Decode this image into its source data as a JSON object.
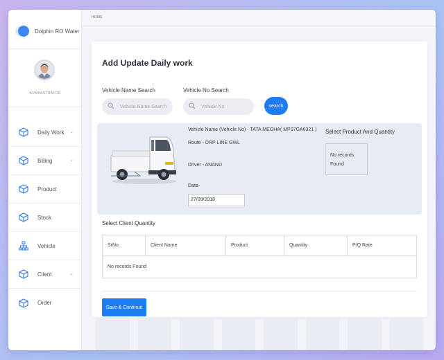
{
  "brand": {
    "name": "Dolphin RO Water"
  },
  "profile": {
    "role": "ADMINISTRATOR"
  },
  "sidebar": {
    "items": [
      {
        "label": "Daily Work",
        "icon": "cube-icon",
        "chevron": true
      },
      {
        "label": "Billing",
        "icon": "cube-icon",
        "chevron": true
      },
      {
        "label": "Product",
        "icon": "cube-icon",
        "chevron": false
      },
      {
        "label": "Stock",
        "icon": "cube-icon",
        "chevron": false
      },
      {
        "label": "Vehicle",
        "icon": "sitemap-icon",
        "chevron": false
      },
      {
        "label": "Client",
        "icon": "cube-icon",
        "chevron": true
      },
      {
        "label": "Order",
        "icon": "cube-icon",
        "chevron": false
      }
    ]
  },
  "breadcrumb": {
    "home": "HOME"
  },
  "form": {
    "title": "Add Update Daily work",
    "vehicle_name_label": "Vehicle Name Search",
    "vehicle_name_placeholder": "Vehicle Name Search",
    "vehicle_no_label": "Vehicle No Search",
    "vehicle_no_placeholder": "Vehicle No",
    "search_label": "search"
  },
  "vehicle": {
    "name_line": "Vehicle Name (Vehicle No) - TATA MEGHA( MP07GA6321 )",
    "route_line": "Route - DRP LINE GWL",
    "driver_line": "Driver - ANAND",
    "date_label": "Date-",
    "date_value": "27/09/2018"
  },
  "product": {
    "title": "Select Product And Quantity",
    "empty_line1": "No records",
    "empty_line2": "Found"
  },
  "client": {
    "title": "Select Client Quantity",
    "columns": [
      "SrNo.",
      "Client Name",
      "Product",
      "Quantity",
      "P/Q Rate"
    ],
    "empty": "No records Found"
  },
  "actions": {
    "save_label": "Save & Continue"
  },
  "colors": {
    "accent": "#1f7cf0",
    "panel": "#e7ebf4"
  }
}
